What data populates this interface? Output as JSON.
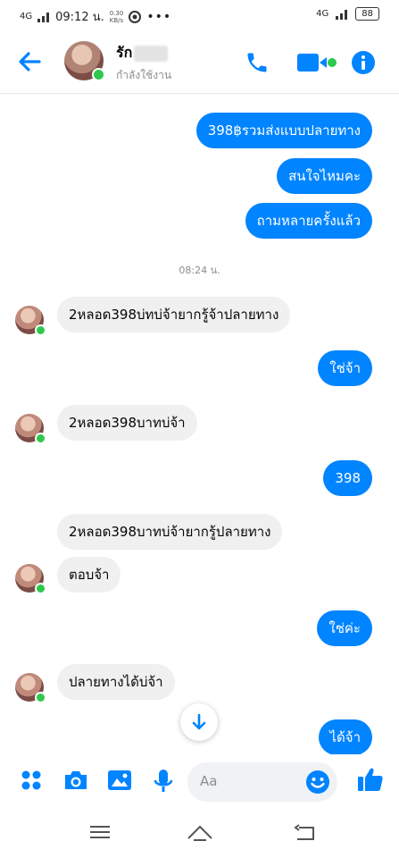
{
  "status_bar": {
    "network": "4G",
    "time": "09:12 น.",
    "speed": "0.30\nKB/s",
    "network_right": "4G",
    "battery": "88"
  },
  "header": {
    "contact_name": "รัก",
    "status": "กำลังใช้งาน"
  },
  "timestamp": "08:24 น.",
  "messages": [
    {
      "dir": "out",
      "text": "398฿รวมส่งแบบปลายทาง"
    },
    {
      "dir": "out",
      "text": "สนใจไหมคะ"
    },
    {
      "dir": "out",
      "text": "ถามหลายครั้งแล้ว"
    },
    {
      "dir": "in",
      "text": "2หลอด398บ่ทบ่จ้ายากรู้จ้าปลายทาง"
    },
    {
      "dir": "out",
      "text": "ใช่จ้า"
    },
    {
      "dir": "in",
      "text": "2หลอด398บาทบ่จ้า"
    },
    {
      "dir": "out",
      "text": "398"
    },
    {
      "dir": "in",
      "text": "2หลอด398บาทบ่จ้ายากรู้ปลายทาง"
    },
    {
      "dir": "in",
      "text": "ตอบจ้า"
    },
    {
      "dir": "out",
      "text": "ใช่ค่ะ"
    },
    {
      "dir": "in",
      "text": "ปลายทางได้บ่จ้า"
    },
    {
      "dir": "out",
      "text": "ได้จ้า"
    }
  ],
  "composer": {
    "placeholder": "Aa"
  },
  "colors": {
    "accent": "#0084ff",
    "incoming_bg": "#f0f0f0",
    "online": "#2dc84d"
  }
}
